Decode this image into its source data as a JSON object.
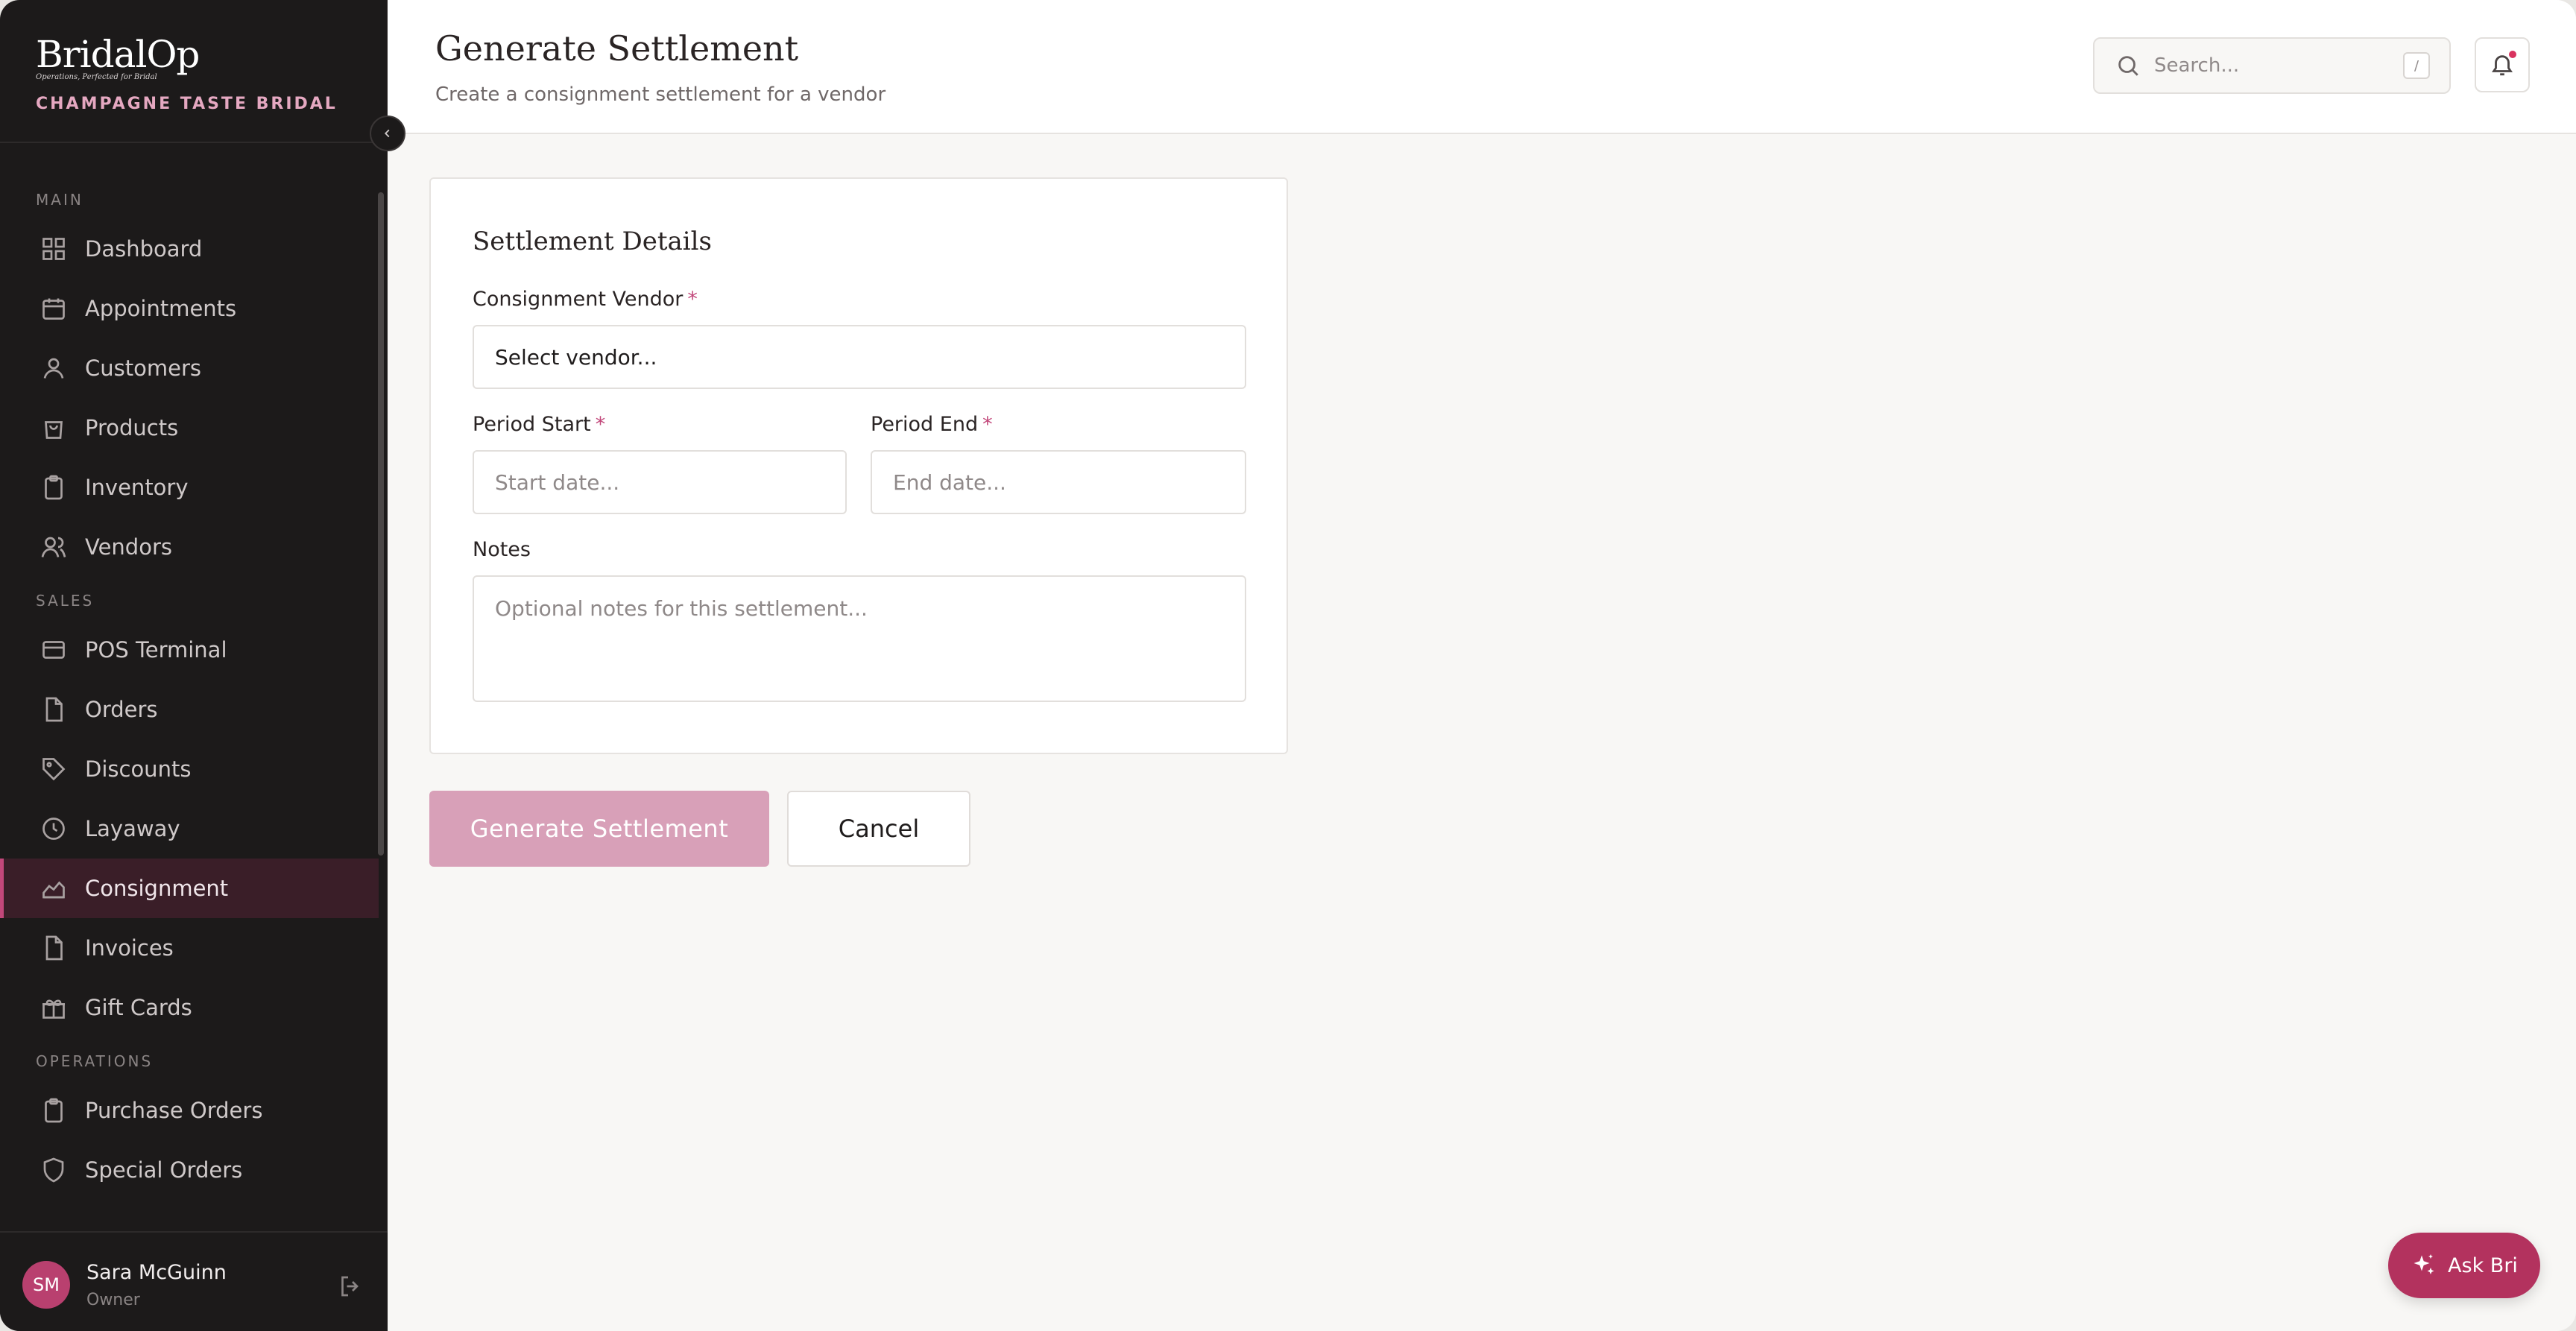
{
  "brand": {
    "name": "BridalOp",
    "tagline": "Operations, Perfected for Bridal",
    "store": "CHAMPAGNE TASTE BRIDAL"
  },
  "nav": {
    "sections": [
      {
        "title": "MAIN",
        "items": [
          {
            "label": "Dashboard",
            "icon": "grid-icon"
          },
          {
            "label": "Appointments",
            "icon": "calendar-icon"
          },
          {
            "label": "Customers",
            "icon": "user-icon"
          },
          {
            "label": "Products",
            "icon": "bag-icon"
          },
          {
            "label": "Inventory",
            "icon": "clipboard-icon"
          },
          {
            "label": "Vendors",
            "icon": "users-icon"
          }
        ]
      },
      {
        "title": "SALES",
        "items": [
          {
            "label": "POS Terminal",
            "icon": "card-icon"
          },
          {
            "label": "Orders",
            "icon": "file-icon"
          },
          {
            "label": "Discounts",
            "icon": "tag-icon"
          },
          {
            "label": "Layaway",
            "icon": "clock-icon"
          },
          {
            "label": "Consignment",
            "icon": "chart-icon",
            "active": true
          },
          {
            "label": "Invoices",
            "icon": "file-icon"
          },
          {
            "label": "Gift Cards",
            "icon": "gift-icon"
          }
        ]
      },
      {
        "title": "OPERATIONS",
        "items": [
          {
            "label": "Purchase Orders",
            "icon": "clipboard-icon"
          },
          {
            "label": "Special Orders",
            "icon": "shield-icon"
          }
        ]
      }
    ]
  },
  "user": {
    "initials": "SM",
    "name": "Sara McGuinn",
    "role": "Owner"
  },
  "header": {
    "title": "Generate Settlement",
    "subtitle": "Create a consignment settlement for a vendor",
    "search_placeholder": "Search...",
    "search_shortcut": "/"
  },
  "form": {
    "card_title": "Settlement Details",
    "vendor_label": "Consignment Vendor",
    "vendor_value": "Select vendor...",
    "start_label": "Period Start",
    "start_placeholder": "Start date...",
    "end_label": "Period End",
    "end_placeholder": "End date...",
    "notes_label": "Notes",
    "notes_placeholder": "Optional notes for this settlement...",
    "required_mark": "*"
  },
  "actions": {
    "submit": "Generate Settlement",
    "cancel": "Cancel"
  },
  "assistant": {
    "label": "Ask Bri"
  },
  "colors": {
    "accent": "#c2477a",
    "primary_button": "#d8a0b8",
    "sidebar_bg": "#1c1a1a",
    "ask_button": "#b3325e"
  }
}
